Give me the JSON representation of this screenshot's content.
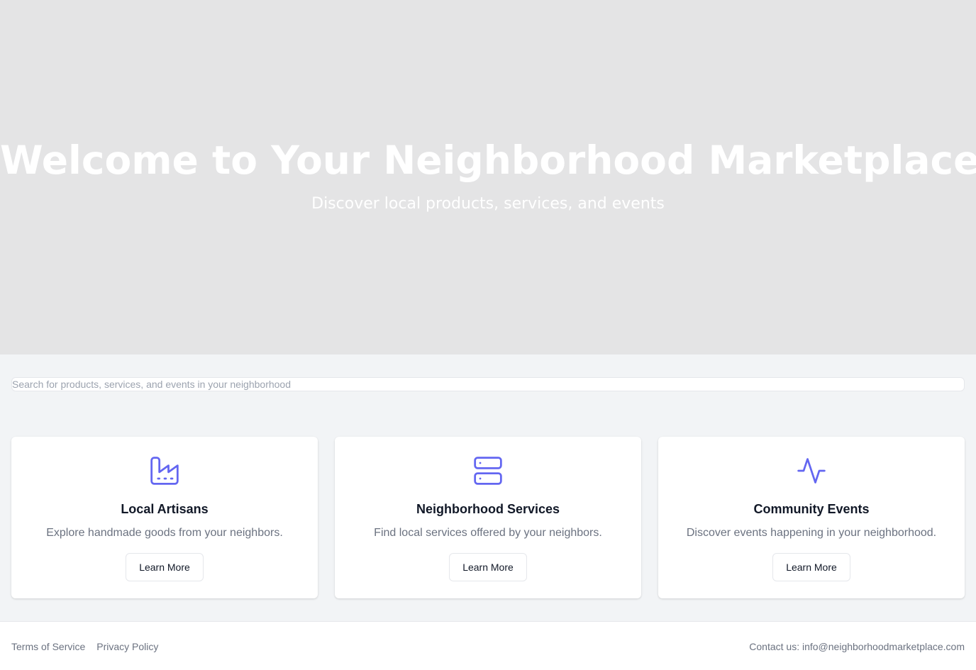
{
  "hero": {
    "title": "Welcome to Your Neighborhood Marketplace",
    "subtitle": "Discover local products, services, and events"
  },
  "search": {
    "placeholder": "Search for products, services, and events in your neighborhood",
    "value": ""
  },
  "cards": [
    {
      "icon": "factory-icon",
      "title": "Local Artisans",
      "description": "Explore handmade goods from your neighbors.",
      "button_label": "Learn More"
    },
    {
      "icon": "server-icon",
      "title": "Neighborhood Services",
      "description": "Find local services offered by your neighbors.",
      "button_label": "Learn More"
    },
    {
      "icon": "activity-icon",
      "title": "Community Events",
      "description": "Discover events happening in your neighborhood.",
      "button_label": "Learn More"
    }
  ],
  "footer": {
    "links": [
      "Terms of Service",
      "Privacy Policy"
    ],
    "contact": "Contact us: info@neighborhoodmarketplace.com"
  },
  "colors": {
    "accent": "#6366f1",
    "hero_background": "#e4e4e5",
    "page_background": "#f2f4f6"
  }
}
